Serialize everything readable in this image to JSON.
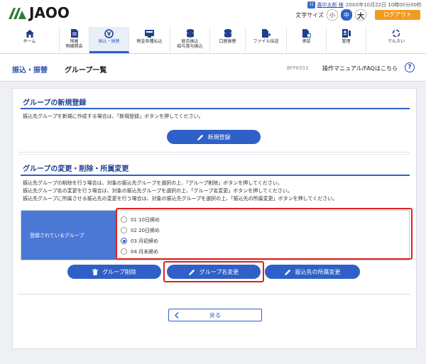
{
  "header": {
    "brand": "JAOO",
    "user_badge": "ﾏｽ",
    "user_name": "農中太郎 様",
    "datetime": "20XX年10月22日 10時00分00秒",
    "font_size_label": "文字サイズ",
    "font_sizes": [
      "小",
      "中",
      "大"
    ],
    "font_size_selected": "中",
    "logout_label": "ログアウト",
    "colors": {
      "accent": "#2f60c7",
      "logout": "#f29c1f"
    }
  },
  "nav": {
    "items": [
      {
        "label": "ホーム",
        "icon": "home-icon"
      },
      {
        "label": "残高\n明細照会",
        "icon": "document-icon"
      },
      {
        "label": "振込・振替",
        "icon": "yen-icon",
        "active": true
      },
      {
        "label": "税金各種払込",
        "icon": "card-icon"
      },
      {
        "label": "総合振込\n給与賞与振込",
        "icon": "coins-icon"
      },
      {
        "label": "口座振替",
        "icon": "coins-icon"
      },
      {
        "label": "ファイル伝送",
        "icon": "file-transfer-icon"
      },
      {
        "label": "承認",
        "icon": "approval-icon"
      },
      {
        "label": "管理",
        "icon": "admin-icon"
      },
      {
        "label": "でんさい",
        "icon": "densai-icon"
      }
    ]
  },
  "subheader": {
    "breadcrumb": "振込・振替",
    "title": "グループ一覧",
    "screen_id": "BFFK011",
    "manual_link": "操作マニュアル/FAQはこちら",
    "help_icon": "?"
  },
  "new_section": {
    "title": "グループの新規登録",
    "description": "振込先グループを新規に作成する場合は、「新規登録」ボタンを押してください。",
    "button_label": "新規登録"
  },
  "edit_section": {
    "title": "グループの変更・削除・所属変更",
    "descriptions": [
      "振込先グループの削除を行う場合は、対象の振込先グループを選択の上、「グループ削除」ボタンを押してください。",
      "振込先グループ名の変更を行う場合は、対象の振込先グループを選択の上、「グループ名変更」ボタンを押してください。",
      "振込先グループに所属させる振込先の変更を行う場合は、対象の振込先グループを選択の上、「振込先の所属変更」ボタンを押してください。"
    ],
    "table_header": "登録されているグループ",
    "groups": [
      {
        "label": "01 10日締め",
        "checked": false
      },
      {
        "label": "02 20日締め",
        "checked": false
      },
      {
        "label": "03 月初締め",
        "checked": true
      },
      {
        "label": "04 月末締め",
        "checked": false
      }
    ],
    "buttons": {
      "delete": "グループ削除",
      "rename": "グループ名変更",
      "membership": "振込先の所属変更"
    }
  },
  "back_label": "戻る"
}
